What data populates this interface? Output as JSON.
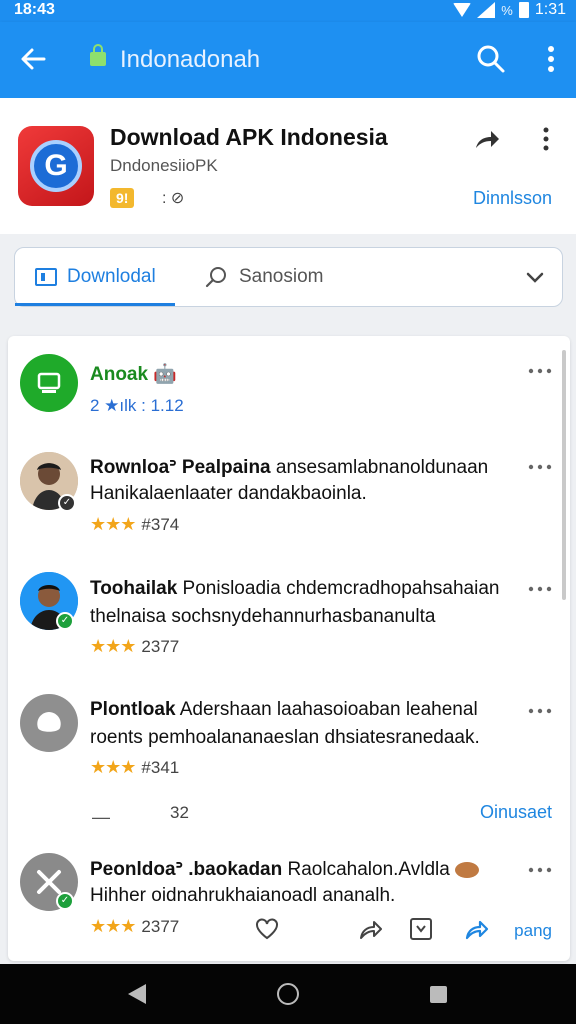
{
  "status_bar": {
    "time": "18:43",
    "battery_text": "%",
    "clock": "1:31"
  },
  "app_bar": {
    "title": "Indonadonah"
  },
  "app_card": {
    "name": "Download APK Indonesia",
    "developer": "DndonesiioPK",
    "badge": "9!",
    "meta": ": ⊘",
    "action": "Dinnlsson",
    "icon_letter": "G"
  },
  "tabs": {
    "download": "Downlodal",
    "search": "Sanosiom"
  },
  "list": {
    "header_item": {
      "title": "Anoak",
      "rating": "2 ★ılk : 1.12"
    },
    "rows": [
      {
        "title_bold": "Rownloaᐣ Pealpaina",
        "title_rest": " ansesamlabnanoldunaan",
        "sub": "Hanikalaenlaater dandakbaoinla.",
        "rating": "#374",
        "stars": "★★★"
      },
      {
        "title_bold": "Toohailak",
        "title_rest": " Ponisloadia chdemcradhopahsahaian",
        "sub": "thelnaisa sochsnydehannurhasbananulta",
        "rating": "2377",
        "stars": "★★★"
      },
      {
        "title_bold": "Plontloak",
        "title_rest": " Adershaan laahasoioaban leahenal",
        "sub": "roents pemhoalananaeslan dhsiatesranedaak.",
        "rating": "#341",
        "stars": "★★★"
      },
      {
        "title_bold": "Peonldoaᐣ .baokadan",
        "title_rest": " Raolcahalon.Avldla",
        "sub": "Hihher oidnahrukhaianoadl ananalh.",
        "rating": "2377",
        "stars": "★★★"
      }
    ],
    "divider_left": "—",
    "divider_num": "32",
    "divider_link": "Oinusaet",
    "action_link": "pang"
  }
}
